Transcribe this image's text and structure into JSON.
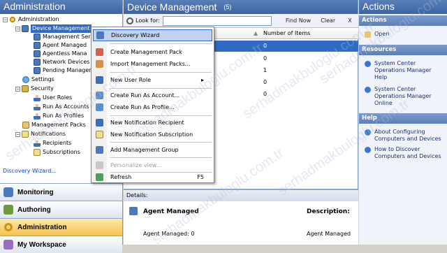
{
  "left_pane": {
    "title": "Administration",
    "tree": [
      {
        "label": "Administration",
        "icon": "gear-icon",
        "expander": "−"
      },
      {
        "label": "Device Management",
        "icon": "monitor-icon",
        "expander": "−"
      },
      {
        "label": "Management Ser",
        "icon": "server-icon"
      },
      {
        "label": "Agent Managed",
        "icon": "agent-icon"
      },
      {
        "label": "Agentless Mana",
        "icon": "agentless-icon"
      },
      {
        "label": "Network Devices",
        "icon": "network-icon"
      },
      {
        "label": "Pending Manager",
        "icon": "pending-icon"
      },
      {
        "label": "Settings",
        "icon": "settings-icon"
      },
      {
        "label": "Security",
        "icon": "lock-icon",
        "expander": "−"
      },
      {
        "label": "User Roles",
        "icon": "user-icon"
      },
      {
        "label": "Run As Accounts",
        "icon": "user-icon"
      },
      {
        "label": "Run As Profiles",
        "icon": "user-icon"
      },
      {
        "label": "Management Packs",
        "icon": "box-icon"
      },
      {
        "label": "Notifications",
        "icon": "envelope-icon",
        "expander": "−"
      },
      {
        "label": "Recipients",
        "icon": "user-icon"
      },
      {
        "label": "Subscriptions",
        "icon": "envelope-icon"
      }
    ],
    "task_link": "Discovery Wizard...",
    "wunderbar": [
      {
        "label": "Monitoring",
        "icon": "monitoring-icon"
      },
      {
        "label": "Authoring",
        "icon": "authoring-icon"
      },
      {
        "label": "Administration",
        "icon": "administration-icon"
      },
      {
        "label": "My Workspace",
        "icon": "workspace-icon"
      }
    ]
  },
  "center_pane": {
    "title": "Device Management",
    "count": "(5)",
    "search": {
      "label": "Look for:",
      "value": "",
      "find_now": "Find Now",
      "clear": "Clear",
      "close": "X"
    },
    "columns": [
      "Number of Items"
    ],
    "rows": [
      "0",
      "0",
      "1",
      "0",
      "0"
    ],
    "details": {
      "header": "Details:",
      "item_title": "Agent Managed",
      "description_label": "Description:",
      "row_label": "Agent Managed: 0",
      "row_value": "Agent Managed"
    }
  },
  "context_menu": {
    "items": [
      {
        "label": "Discovery Wizard",
        "icon": "discovery-wizard-icon"
      },
      {
        "label": "Create Management Pack",
        "icon": "create-mp-icon"
      },
      {
        "label": "Import Management Packs...",
        "icon": "import-mp-icon"
      },
      {
        "label": "New User Role",
        "icon": "user-role-icon",
        "submenu": "▸"
      },
      {
        "label": "Create Run As Account...",
        "icon": "runas-account-icon"
      },
      {
        "label": "Create Run As Profile...",
        "icon": "runas-profile-icon"
      },
      {
        "label": "New Notification Recipient",
        "icon": "recipient-icon"
      },
      {
        "label": "New Notification Subscription",
        "icon": "subscription-icon"
      },
      {
        "label": "Add Management Group",
        "icon": "management-group-icon"
      },
      {
        "label": "Personalize view...",
        "icon": "personalize-icon"
      },
      {
        "label": "Refresh",
        "icon": "refresh-icon",
        "shortcut": "F5"
      }
    ]
  },
  "actions_pane": {
    "title": "Actions",
    "sections": [
      {
        "header": "Actions",
        "items": [
          "Open"
        ]
      },
      {
        "header": "Resources",
        "items": [
          "System Center Operations Manager Help",
          "System Center Operations Manager Online"
        ]
      },
      {
        "header": "Help",
        "items": [
          "About Configuring Computers and Devices",
          "How to Discover Computers and Devices"
        ]
      }
    ]
  },
  "watermark": "serhadmakbuloglu.com.tr",
  "colors": {
    "header": "#3c64a5",
    "selection": "#316ac5",
    "menu_highlight": "#c1d2ee",
    "link": "#1a47c4"
  }
}
